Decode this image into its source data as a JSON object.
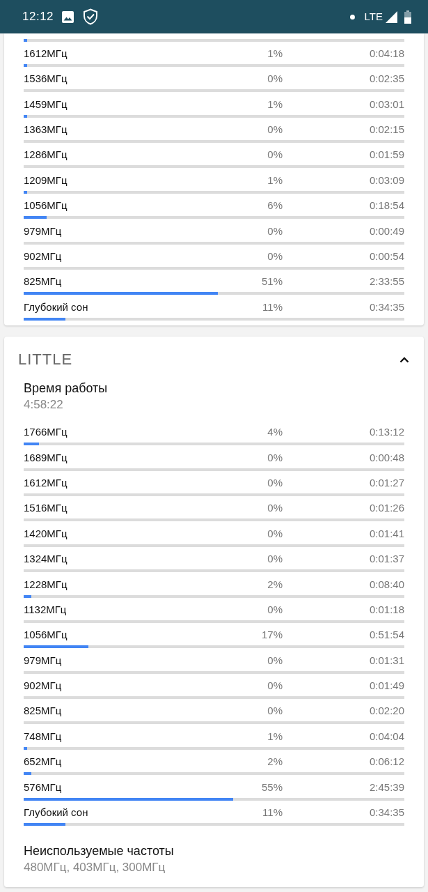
{
  "status_bar": {
    "time": "12:12",
    "network": "LTE"
  },
  "clusters": [
    {
      "cut_row": {
        "level": 0.01
      },
      "rows": [
        {
          "freq": "1612МГц",
          "percent": "1%",
          "time": "0:04:18",
          "level": 0.01
        },
        {
          "freq": "1536МГц",
          "percent": "0%",
          "time": "0:02:35",
          "level": 0
        },
        {
          "freq": "1459МГц",
          "percent": "1%",
          "time": "0:03:01",
          "level": 0.01
        },
        {
          "freq": "1363МГц",
          "percent": "0%",
          "time": "0:02:15",
          "level": 0
        },
        {
          "freq": "1286МГц",
          "percent": "0%",
          "time": "0:01:59",
          "level": 0
        },
        {
          "freq": "1209МГц",
          "percent": "1%",
          "time": "0:03:09",
          "level": 0.01
        },
        {
          "freq": "1056МГц",
          "percent": "6%",
          "time": "0:18:54",
          "level": 0.06
        },
        {
          "freq": "979МГц",
          "percent": "0%",
          "time": "0:00:49",
          "level": 0
        },
        {
          "freq": "902МГц",
          "percent": "0%",
          "time": "0:00:54",
          "level": 0
        },
        {
          "freq": "825МГц",
          "percent": "51%",
          "time": "2:33:55",
          "level": 0.51
        },
        {
          "freq": "Глубокий сон",
          "percent": "11%",
          "time": "0:34:35",
          "level": 0.11
        }
      ]
    },
    {
      "title": "LITTLE",
      "expanded": true,
      "uptime": {
        "label": "Время работы",
        "value": "4:58:22"
      },
      "rows": [
        {
          "freq": "1766МГц",
          "percent": "4%",
          "time": "0:13:12",
          "level": 0.04
        },
        {
          "freq": "1689МГц",
          "percent": "0%",
          "time": "0:00:48",
          "level": 0
        },
        {
          "freq": "1612МГц",
          "percent": "0%",
          "time": "0:01:27",
          "level": 0
        },
        {
          "freq": "1516МГц",
          "percent": "0%",
          "time": "0:01:26",
          "level": 0
        },
        {
          "freq": "1420МГц",
          "percent": "0%",
          "time": "0:01:41",
          "level": 0
        },
        {
          "freq": "1324МГц",
          "percent": "0%",
          "time": "0:01:37",
          "level": 0
        },
        {
          "freq": "1228МГц",
          "percent": "2%",
          "time": "0:08:40",
          "level": 0.02
        },
        {
          "freq": "1132МГц",
          "percent": "0%",
          "time": "0:01:18",
          "level": 0
        },
        {
          "freq": "1056МГц",
          "percent": "17%",
          "time": "0:51:54",
          "level": 0.17
        },
        {
          "freq": "979МГц",
          "percent": "0%",
          "time": "0:01:31",
          "level": 0
        },
        {
          "freq": "902МГц",
          "percent": "0%",
          "time": "0:01:49",
          "level": 0
        },
        {
          "freq": "825МГц",
          "percent": "0%",
          "time": "0:02:20",
          "level": 0
        },
        {
          "freq": "748МГц",
          "percent": "1%",
          "time": "0:04:04",
          "level": 0.01
        },
        {
          "freq": "652МГц",
          "percent": "2%",
          "time": "0:06:12",
          "level": 0.02
        },
        {
          "freq": "576МГц",
          "percent": "55%",
          "time": "2:45:39",
          "level": 0.55
        },
        {
          "freq": "Глубокий сон",
          "percent": "11%",
          "time": "0:34:35",
          "level": 0.11
        }
      ],
      "unused": {
        "label": "Неиспользуемые частоты",
        "value": "480МГц, 403МГц, 300МГц"
      }
    }
  ]
}
